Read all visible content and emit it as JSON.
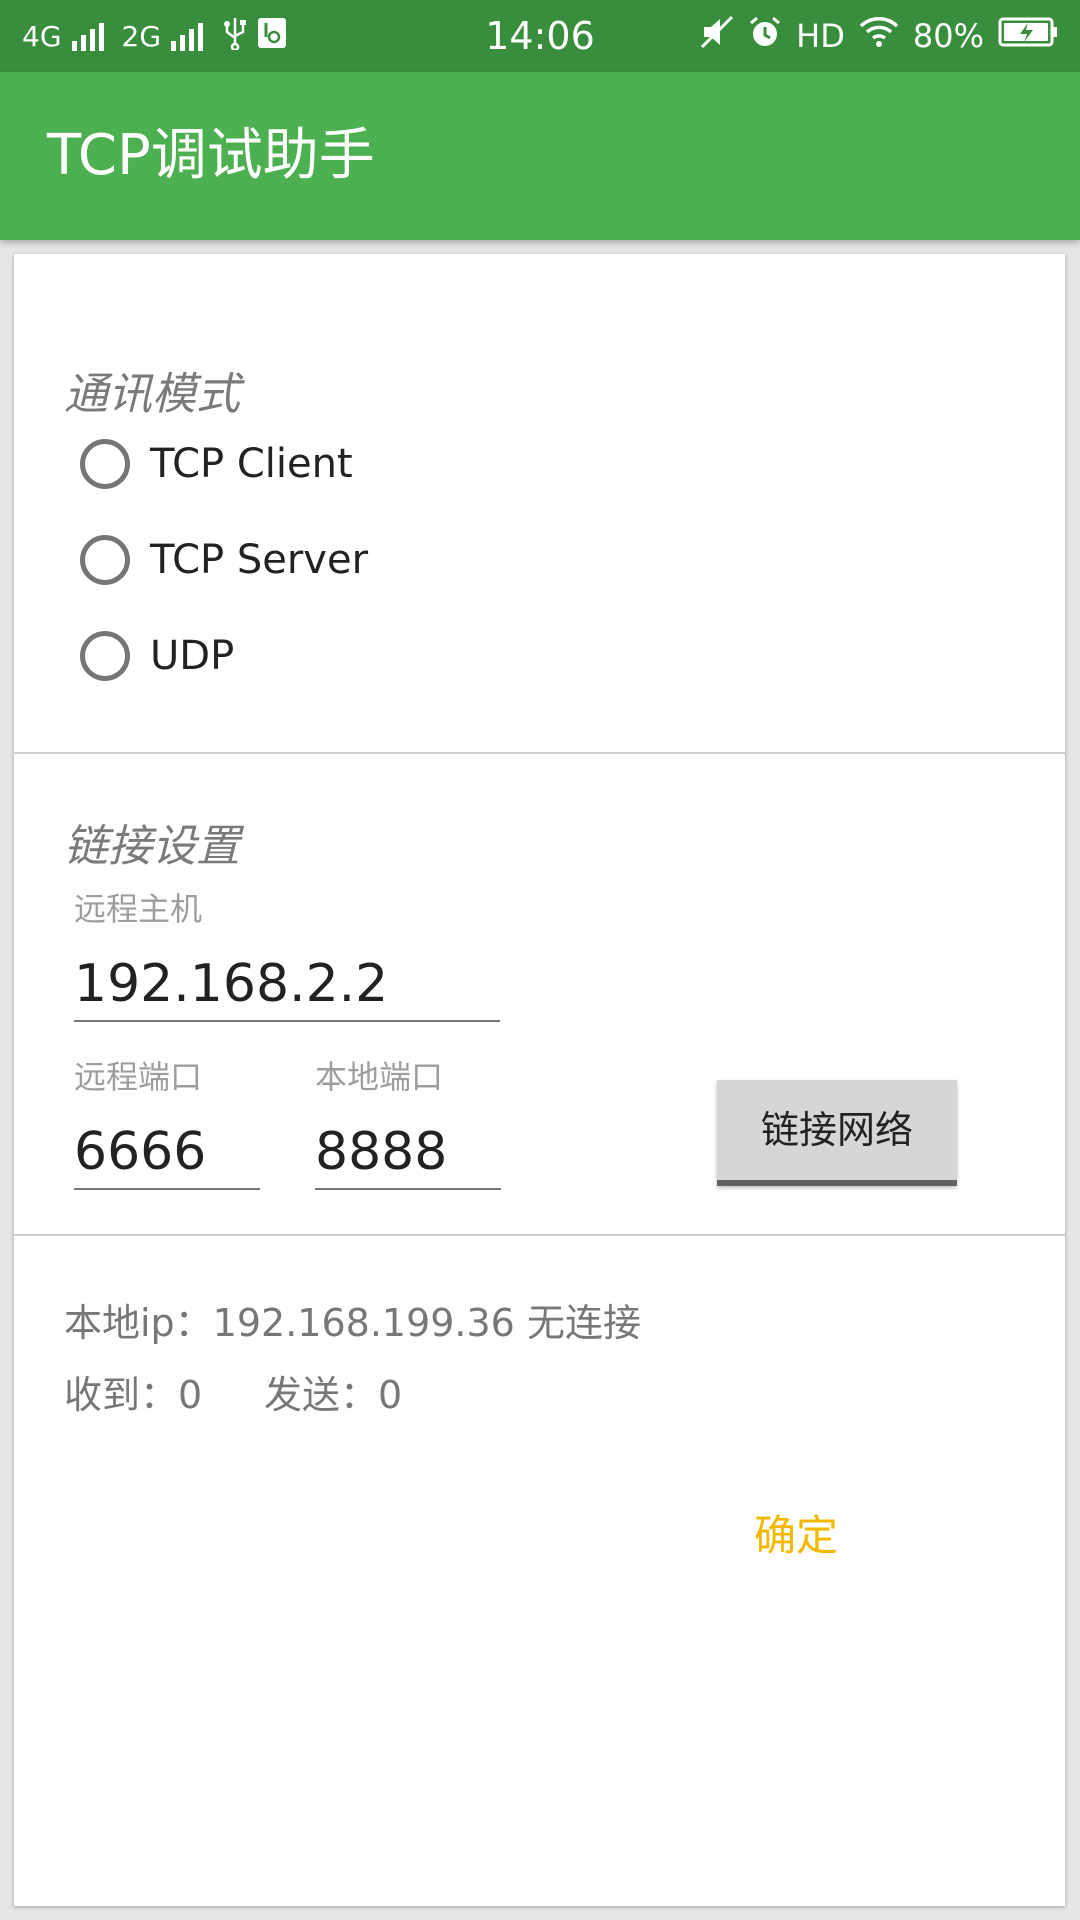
{
  "status_bar": {
    "network1": "4G",
    "network2": "2G",
    "time": "14:06",
    "hd": "HD",
    "battery": "80%"
  },
  "app_bar": {
    "title": "TCP调试助手"
  },
  "comm_mode": {
    "title": "通讯模式",
    "options": [
      "TCP Client",
      "TCP Server",
      "UDP"
    ]
  },
  "link_settings": {
    "title": "链接设置",
    "remote_host": {
      "label": "远程主机",
      "value": "192.168.2.2"
    },
    "remote_port": {
      "label": "远程端口",
      "value": "6666"
    },
    "local_port": {
      "label": "本地端口",
      "value": "8888"
    },
    "connect_button": "链接网络"
  },
  "status": {
    "local_ip_line": "本地ip：192.168.199.36 无连接",
    "received": "收到：0",
    "sent": "发送：0"
  },
  "ok_button": "确定",
  "colors": {
    "status_bar": "#388e3c",
    "app_bar": "#4caf50",
    "accent": "#f5b800"
  }
}
